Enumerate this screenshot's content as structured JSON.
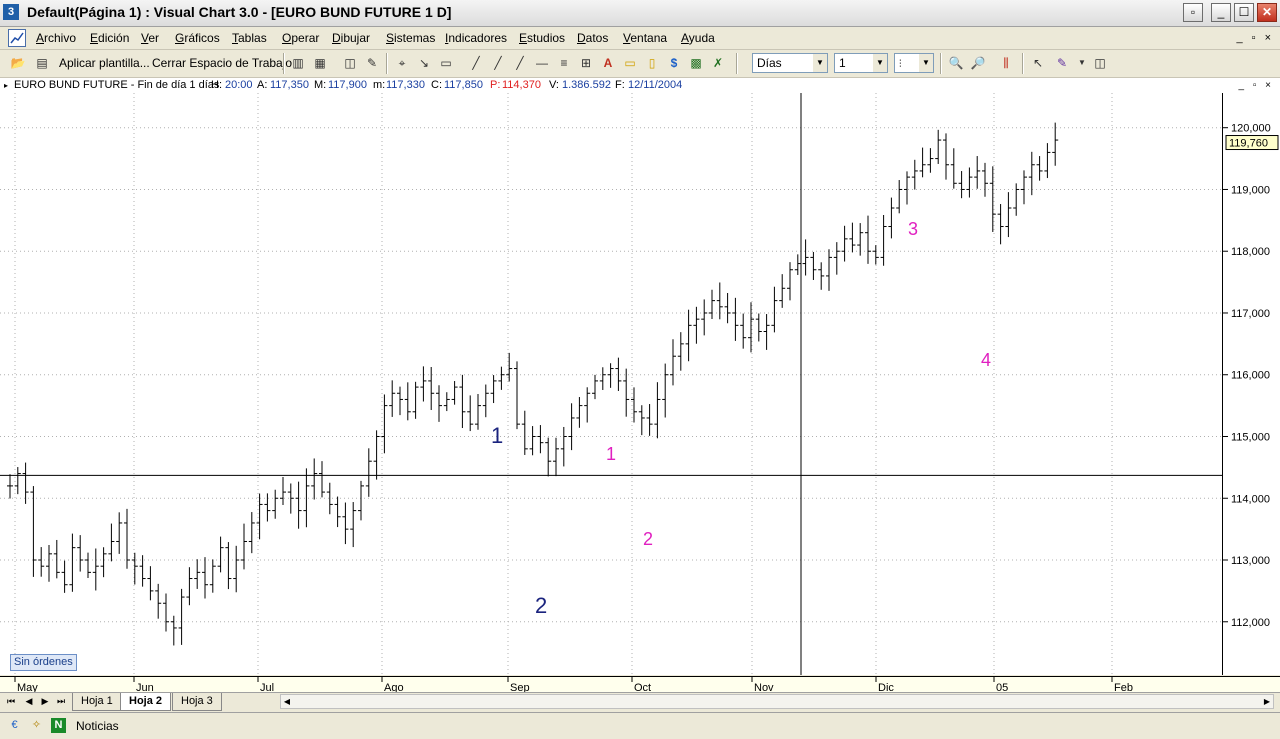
{
  "window": {
    "title": "Default(Página 1) : Visual Chart   3.0 - [EURO BUND FUTURE 1 D]",
    "app_icon": "visual-chart-icon",
    "controls": {
      "minimize": "_",
      "maximize": "☐",
      "close": "✕"
    }
  },
  "menu": {
    "items": [
      "Archivo",
      "Edición",
      "Ver",
      "Gráficos",
      "Tablas",
      "Operar",
      "Dibujar",
      "Sistemas",
      "Indicadores",
      "Estudios",
      "Datos",
      "Ventana",
      "Ayuda"
    ],
    "mdi_controls": "_ ▫ ×"
  },
  "toolbar": {
    "apply_template_label": "Aplicar plantilla...",
    "close_workspace_label": "Cerrar Espacio de Trabajo",
    "period_select": "Días",
    "period_value": "1"
  },
  "infobar": {
    "symbol": "EURO BUND FUTURE - Fin de día 1 días",
    "hour_label": "H:",
    "hour": "20:00",
    "open_label": "A:",
    "open": "117,350",
    "high_label": "M:",
    "high": "117,900",
    "low_label": "m:",
    "low": "117,330",
    "close_label": "C:",
    "close": "117,850",
    "p_label": "P:",
    "p": "114,370",
    "volume_label": "V:",
    "volume": "1.386.592",
    "date_label": "F:",
    "date": "12/11/2004",
    "window_controls": "_ ▫ ×"
  },
  "chart_data": {
    "type": "ohlc",
    "instrument": "EURO BUND FUTURE",
    "y_ticks": [
      "112,000",
      "113,000",
      "114,000",
      "115,000",
      "116,000",
      "117,000",
      "118,000",
      "119,000",
      "120,000"
    ],
    "ylim": [
      111.3,
      120.4
    ],
    "x_ticks": [
      "May",
      "Jun",
      "Jul",
      "Ago",
      "Sep",
      "Oct",
      "Nov",
      "Dic",
      "05",
      "Feb"
    ],
    "last_price": "119,760",
    "crosshair_price": 114.37,
    "grid": true,
    "annotations": [
      {
        "text": "1",
        "color": "#1a237e",
        "near": "Sep peak"
      },
      {
        "text": "2",
        "color": "#1a237e",
        "near": "Sep low"
      },
      {
        "text": "1",
        "color": "#e020c0",
        "near": "Sep/Oct peak"
      },
      {
        "text": "2",
        "color": "#e020c0",
        "near": "Oct low"
      },
      {
        "text": "3",
        "color": "#e020c0",
        "near": "Dec peak"
      },
      {
        "text": "4",
        "color": "#e020c0",
        "near": "Jan low"
      }
    ],
    "closes": [
      114.2,
      114.4,
      114.1,
      113.0,
      112.9,
      113.1,
      112.8,
      112.6,
      113.2,
      113.0,
      112.8,
      112.9,
      113.1,
      113.3,
      113.6,
      113.0,
      112.9,
      112.7,
      112.5,
      112.3,
      112.0,
      111.9,
      112.4,
      112.7,
      112.8,
      112.6,
      112.9,
      113.2,
      112.7,
      113.0,
      113.3,
      113.6,
      113.9,
      113.8,
      114.0,
      114.1,
      114.0,
      113.8,
      114.2,
      114.4,
      114.1,
      113.9,
      113.7,
      113.5,
      113.8,
      114.2,
      114.6,
      115.0,
      115.5,
      115.7,
      115.6,
      115.4,
      115.8,
      115.9,
      115.7,
      115.5,
      115.6,
      115.8,
      115.4,
      115.2,
      115.5,
      115.7,
      115.9,
      116.0,
      116.1,
      115.2,
      114.8,
      115.0,
      114.9,
      114.6,
      114.8,
      115.0,
      115.3,
      115.5,
      115.7,
      115.9,
      116.0,
      116.1,
      115.9,
      115.6,
      115.4,
      115.3,
      115.2,
      115.6,
      116.0,
      116.3,
      116.5,
      116.8,
      116.9,
      117.0,
      117.2,
      117.1,
      117.0,
      116.8,
      116.6,
      116.9,
      116.7,
      116.8,
      117.2,
      117.4,
      117.7,
      117.8,
      117.9,
      117.7,
      117.6,
      117.9,
      118.0,
      118.2,
      118.1,
      118.3,
      118.0,
      117.9,
      118.4,
      118.7,
      119.0,
      119.2,
      119.3,
      119.4,
      119.5,
      119.8,
      119.4,
      119.1,
      119.0,
      119.2,
      119.3,
      119.1,
      118.6,
      118.4,
      118.7,
      119.0,
      119.2,
      119.4,
      119.3,
      119.6,
      119.8
    ],
    "series_color": "#000000"
  },
  "chart_overlay": {
    "orders_label": "Sin órdenes"
  },
  "sheets": {
    "tabs": [
      "Hoja 1",
      "Hoja 2",
      "Hoja 3"
    ],
    "active": "Hoja 2"
  },
  "status": {
    "news_label": "Noticias"
  }
}
